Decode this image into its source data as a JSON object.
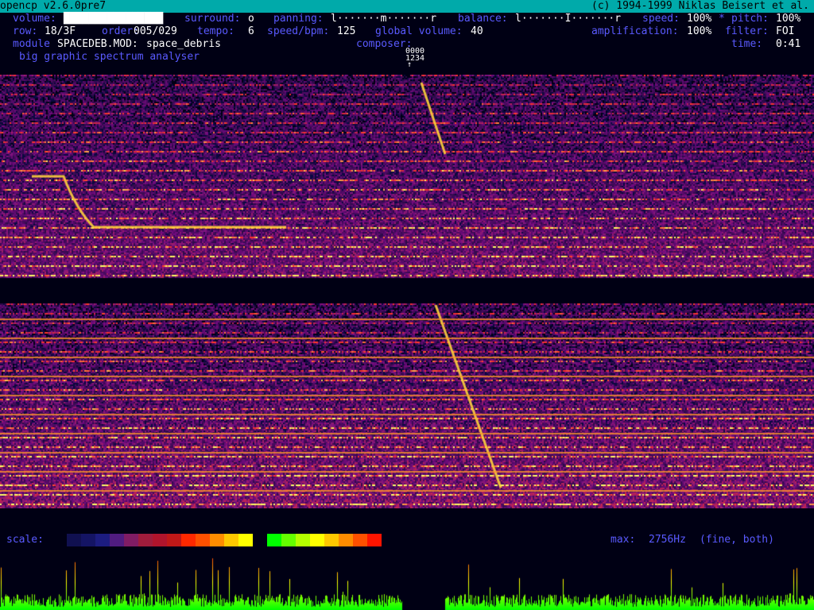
{
  "header": {
    "app_title": "opencp v2.6.0pre7",
    "copyright": "(c) 1994-1999 Niklas Beisert et al."
  },
  "status": {
    "volume_label": "volume:",
    "volume_bar": "████████████████",
    "surround_label": "surround:",
    "surround_value": "o",
    "panning_label": "panning:",
    "panning_value": "l·······m·······r",
    "balance_label": "balance:",
    "balance_value": "l·······I·······r",
    "speed_label": "speed:",
    "speed_value": "100%",
    "lock_symbol": "*",
    "pitch_label": "pitch:",
    "pitch_value": "100%",
    "row_label": "row:",
    "row_value": "18/3F",
    "order_label": "order:",
    "order_value": "005/029",
    "tempo_label": "tempo:",
    "tempo_value": "6",
    "speedbpm_label": "speed/bpm:",
    "speedbpm_value": "125",
    "global_volume_label": "global volume:",
    "global_volume_value": "40",
    "amplification_label": "amplification:",
    "amplification_value": "100%",
    "filter_label": "filter:",
    "filter_value": "FOI",
    "module_label": "module",
    "module_file": "SPACEDEB.MOD:",
    "module_name": "space_debris",
    "composer_label": "composer:",
    "composer_value": "",
    "time_label": "time:",
    "time_value": "0:41",
    "mode_title": "big graphic spectrum analyser",
    "channel_row1": "0000",
    "channel_row2": "1234",
    "channel_marker": "↑"
  },
  "footer": {
    "scale_label": "scale:",
    "max_label": "max:",
    "max_value": "2756Hz",
    "mode_value": "(fine, both)"
  },
  "colors": {
    "background": "#000014",
    "titlebar": "#00aaaa",
    "label": "#5a5aff",
    "value": "#ffffff",
    "scale": [
      "#101050",
      "#141464",
      "#1c1c80",
      "#501c80",
      "#801c64",
      "#a01c3c",
      "#b0142c",
      "#c01818",
      "#ff2800",
      "#ff5000",
      "#ff8c00",
      "#ffc800",
      "#ffff00",
      "#000014",
      "#00ff00",
      "#64ff00",
      "#b4ff00",
      "#ffff00",
      "#ffc800",
      "#ff8c00",
      "#ff5000",
      "#ff1400"
    ]
  }
}
